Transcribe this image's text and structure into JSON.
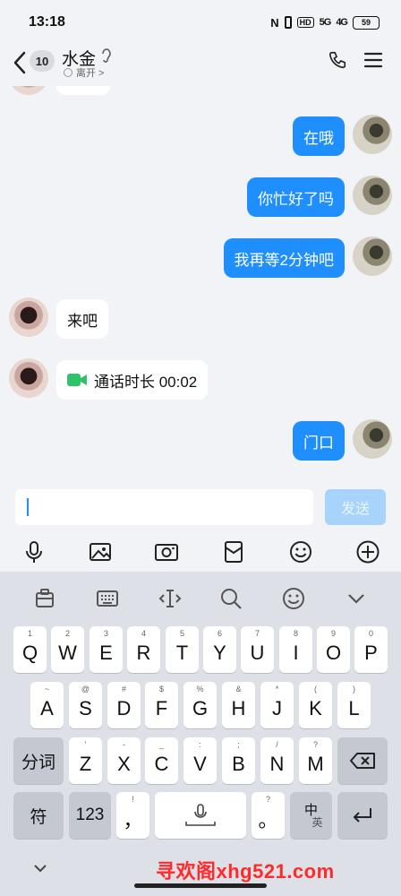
{
  "status_bar": {
    "time": "13:18",
    "nfc": "N",
    "hd": "HD",
    "signal1": "5G",
    "signal2": "4G",
    "battery": "59"
  },
  "header": {
    "unread_count": "10",
    "contact_name": "水金",
    "presence": "离开 >"
  },
  "messages": [
    {
      "side": "out",
      "text": "在哦"
    },
    {
      "side": "out",
      "text": "你忙好了吗"
    },
    {
      "side": "out",
      "text": "我再等2分钟吧"
    },
    {
      "side": "in",
      "text": "来吧"
    },
    {
      "side": "in",
      "type": "video-call",
      "text": "通话时长 00:02"
    },
    {
      "side": "out",
      "text": "门口"
    }
  ],
  "input": {
    "value": "",
    "send_label": "发送"
  },
  "toolbar": {
    "icons": [
      "microphone-icon",
      "image-icon",
      "camera-icon",
      "red-packet-icon",
      "emoji-icon",
      "plus-icon"
    ]
  },
  "keyboard": {
    "tools": [
      "clipboard-icon",
      "keyboard-icon",
      "cursor-icon",
      "search-icon",
      "emoji-icon",
      "collapse-icon"
    ],
    "row1": [
      {
        "k": "Q",
        "s": "1"
      },
      {
        "k": "W",
        "s": "2"
      },
      {
        "k": "E",
        "s": "3"
      },
      {
        "k": "R",
        "s": "4"
      },
      {
        "k": "T",
        "s": "5"
      },
      {
        "k": "Y",
        "s": "6"
      },
      {
        "k": "U",
        "s": "7"
      },
      {
        "k": "I",
        "s": "8"
      },
      {
        "k": "O",
        "s": "9"
      },
      {
        "k": "P",
        "s": "0"
      }
    ],
    "row2": [
      {
        "k": "A",
        "s": "~"
      },
      {
        "k": "S",
        "s": "@"
      },
      {
        "k": "D",
        "s": "#"
      },
      {
        "k": "F",
        "s": "$"
      },
      {
        "k": "G",
        "s": "%"
      },
      {
        "k": "H",
        "s": "&"
      },
      {
        "k": "J",
        "s": "*"
      },
      {
        "k": "K",
        "s": "("
      },
      {
        "k": "L",
        "s": ")"
      }
    ],
    "row3_left": "分词",
    "row3": [
      {
        "k": "Z",
        "s": "'"
      },
      {
        "k": "X",
        "s": "-"
      },
      {
        "k": "C",
        "s": "_"
      },
      {
        "k": "V",
        "s": ":"
      },
      {
        "k": "B",
        "s": ";"
      },
      {
        "k": "N",
        "s": "/"
      },
      {
        "k": "M",
        "s": "?"
      }
    ],
    "row4": {
      "symbols": "符",
      "numbers": "123",
      "comma": "，",
      "comma_sub": "!",
      "period": "。",
      "period_sub": "?",
      "lang_top": "中",
      "lang_bottom": "英"
    }
  },
  "watermark": "寻欢阁xhg521.com"
}
